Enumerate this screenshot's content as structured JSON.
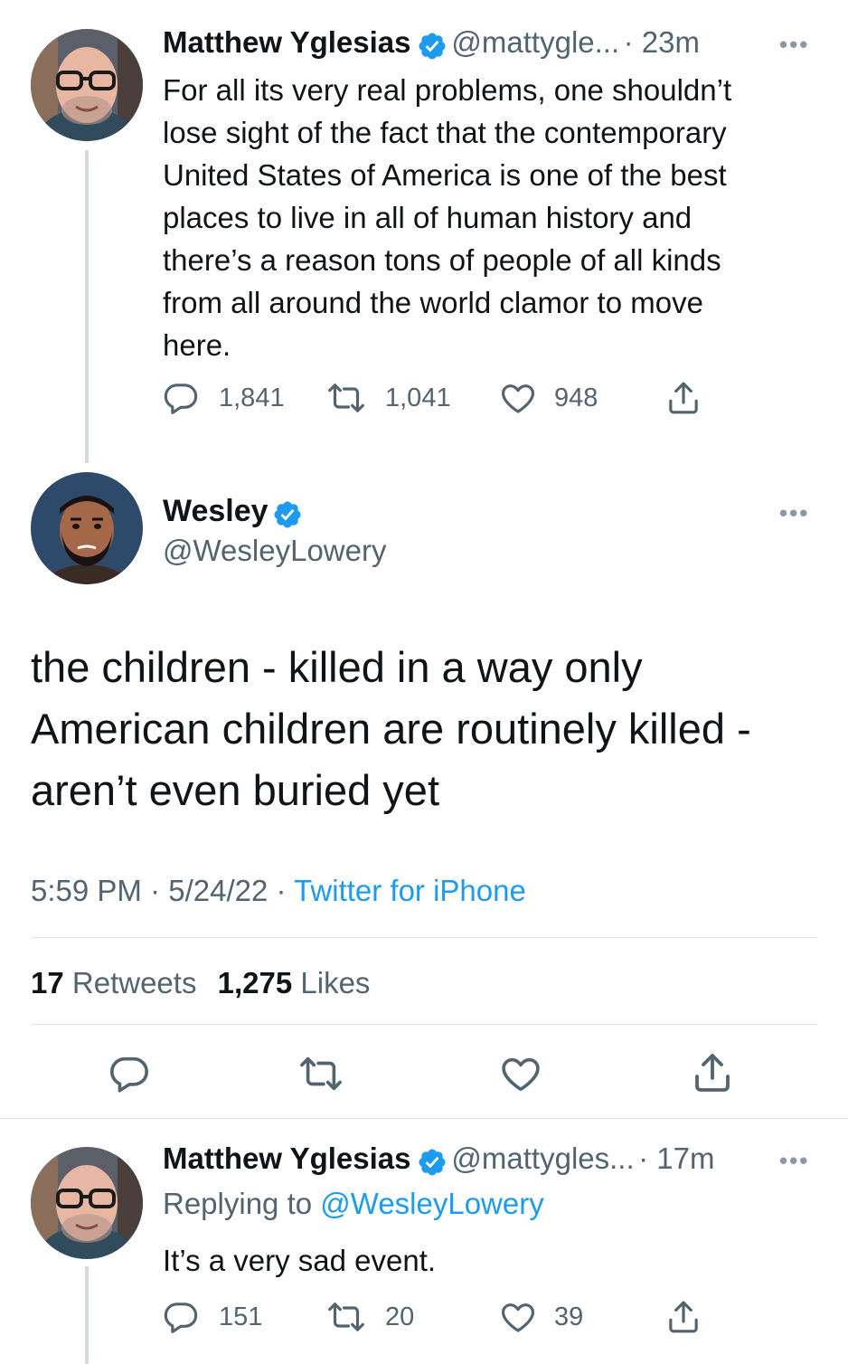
{
  "tweet1": {
    "name": "Matthew Yglesias",
    "handle": "@mattygle...",
    "time": "· 23m",
    "text_lines": [
      "For all its very real problems, one shouldn’t",
      "lose sight of the fact that the contemporary",
      "United States of America is one of the best",
      "places to live in all of human history and",
      "there’s a reason tons of people of all kinds",
      "from all around the world clamor to move",
      "here."
    ],
    "replies": "1,841",
    "retweets": "1,041",
    "likes": "948"
  },
  "main": {
    "name": "Wesley",
    "handle": "@WesleyLowery",
    "text_lines": [
      "the children - killed in a way only",
      "American children are routinely killed -",
      "aren’t even buried yet"
    ],
    "meta_time": "5:59 PM · 5/24/22 · ",
    "meta_source": "Twitter for iPhone",
    "retweets_count": "17",
    "retweets_label": "Retweets",
    "likes_count": "1,275",
    "likes_label": "Likes"
  },
  "tweet3": {
    "name": "Matthew Yglesias",
    "handle": "@mattygles...",
    "time": "· 17m",
    "replying_prefix": "Replying to ",
    "replying_to": "@WesleyLowery",
    "text": "It’s a very sad event.",
    "replies": "151",
    "retweets": "20",
    "likes": "39"
  },
  "more_label": "•••",
  "colors": {
    "accent": "#1d9bf0",
    "muted": "#536471",
    "text": "#0f1419",
    "divider": "#e1e8ed"
  },
  "icons": [
    "verified-badge-icon",
    "reply-icon",
    "retweet-icon",
    "like-icon",
    "share-icon",
    "more-icon"
  ]
}
